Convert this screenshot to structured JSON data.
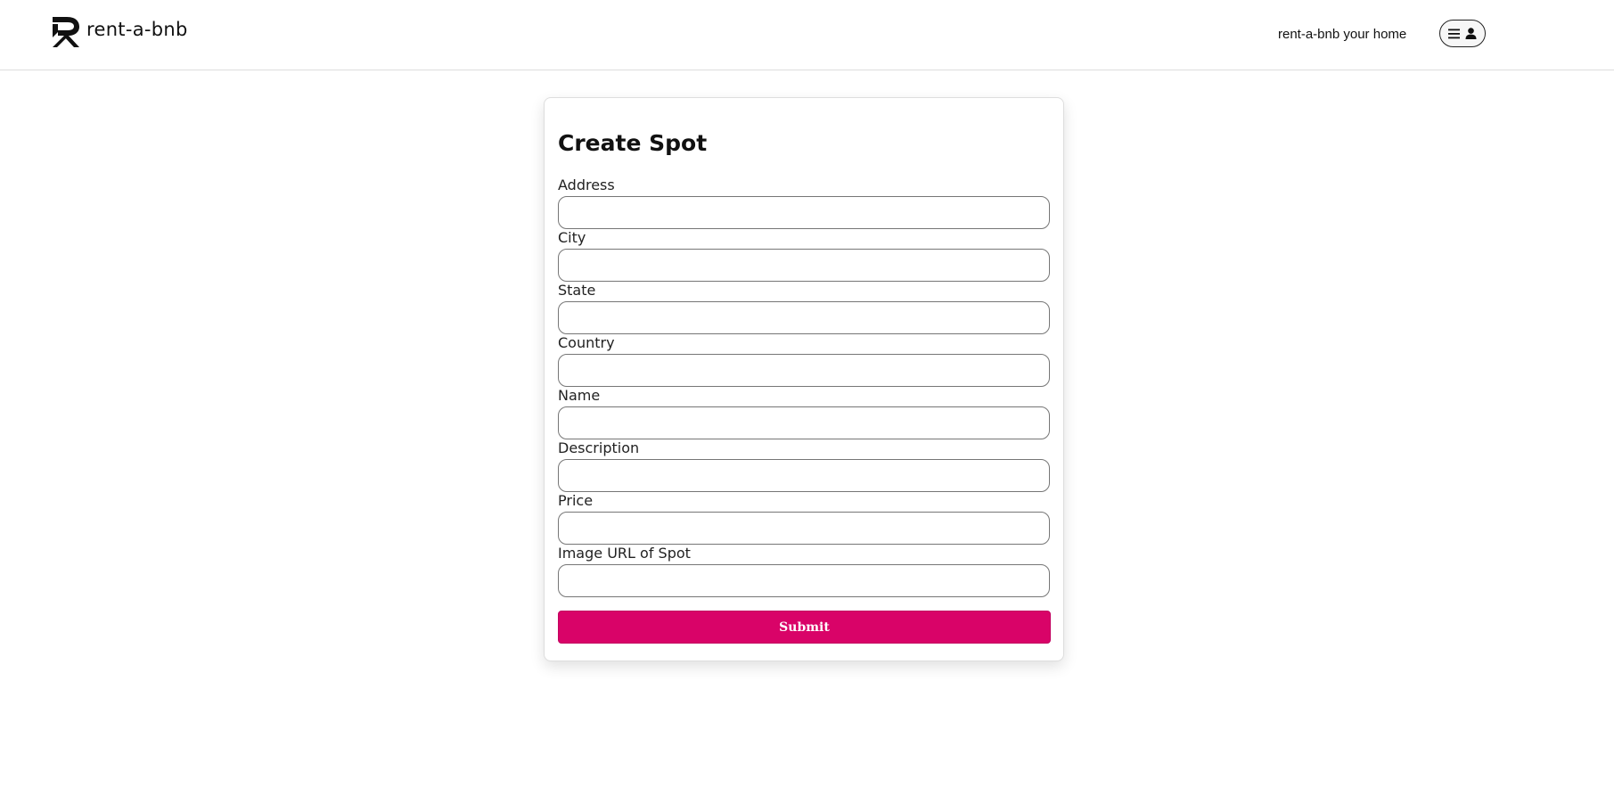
{
  "header": {
    "brand": "rent-a-bnb",
    "host_link": "rent-a-bnb your home",
    "profile_icons": [
      "menu-icon",
      "user-icon"
    ]
  },
  "form": {
    "title": "Create Spot",
    "fields": [
      {
        "label": "Address",
        "value": ""
      },
      {
        "label": "City",
        "value": ""
      },
      {
        "label": "State",
        "value": ""
      },
      {
        "label": "Country",
        "value": ""
      },
      {
        "label": "Name",
        "value": ""
      },
      {
        "label": "Description",
        "value": ""
      },
      {
        "label": "Price",
        "value": ""
      },
      {
        "label": "Image URL of Spot",
        "value": ""
      }
    ],
    "submit_label": "Submit"
  },
  "colors": {
    "accent": "#d90368",
    "border": "#767676",
    "divider": "#dddddd",
    "text": "#222222"
  }
}
